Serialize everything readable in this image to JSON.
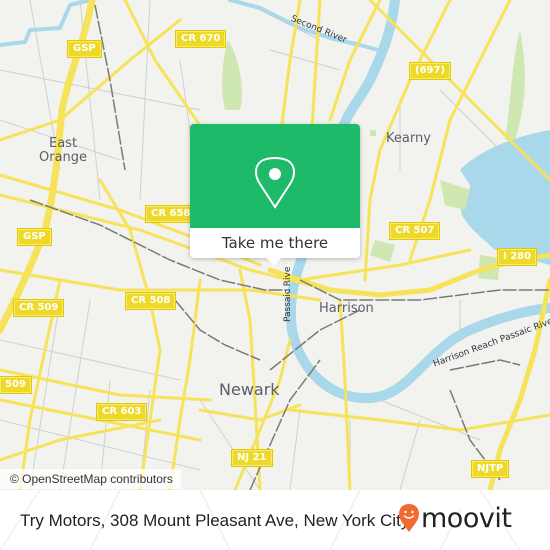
{
  "map": {
    "attribution": "© OpenStreetMap contributors",
    "colors": {
      "land": "#f2f2ee",
      "water": "#a8d8ea",
      "major_road": "#f7e35a",
      "minor_road": "#c8c8c8",
      "rail": "#777777",
      "park": "#cfe7b0",
      "shield": "#efd928"
    },
    "shields": [
      {
        "id": "gsp-north",
        "label": "GSP"
      },
      {
        "id": "cr670",
        "label": "CR 670"
      },
      {
        "id": "cr697",
        "label": "(697)"
      },
      {
        "id": "cr658",
        "label": "CR 658"
      },
      {
        "id": "gsp-south",
        "label": "GSP"
      },
      {
        "id": "cr507",
        "label": "CR 507"
      },
      {
        "id": "i280",
        "label": "I 280"
      },
      {
        "id": "cr509",
        "label": "CR 509"
      },
      {
        "id": "cr508",
        "label": "CR 508"
      },
      {
        "id": "cr509-edge",
        "label": "509"
      },
      {
        "id": "cr603",
        "label": "CR 603"
      },
      {
        "id": "nj21",
        "label": "NJ 21"
      },
      {
        "id": "njtp",
        "label": "NJTP"
      }
    ],
    "places": [
      {
        "id": "east-orange",
        "label": "East\nOrange"
      },
      {
        "id": "kearny",
        "label": "Kearny"
      },
      {
        "id": "harrison",
        "label": "Harrison"
      },
      {
        "id": "newark",
        "label": "Newark"
      }
    ],
    "water_labels": [
      {
        "id": "second-river",
        "label": "Second River"
      },
      {
        "id": "passaic-river",
        "label": "Passaic Rive"
      },
      {
        "id": "harrison-reach",
        "label": "Harrison Reach Passaic Rive"
      }
    ]
  },
  "popup": {
    "icon": "map-pin-icon",
    "cta_label": "Take me there",
    "color": "#1fb96a"
  },
  "footer": {
    "title": "Try Motors, 308 Mount Pleasant Ave, New York City",
    "brand": "moovit",
    "brand_icon": "moovit-smiley-pin-icon",
    "brand_color": "#f26a32"
  }
}
